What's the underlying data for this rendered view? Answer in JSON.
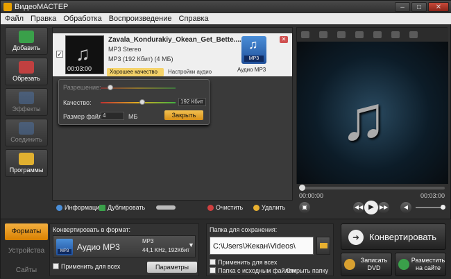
{
  "window": {
    "title": "ВидеоМАСТЕР",
    "minimize": "–",
    "maximize": "□",
    "close": "✕"
  },
  "menu": [
    "Файл",
    "Правка",
    "Обработка",
    "Воспроизведение",
    "Справка"
  ],
  "tools": [
    {
      "label": "Добавить",
      "icon": "add-film-icon",
      "color": "#3aa04a",
      "enabled": true
    },
    {
      "label": "Обрезать",
      "icon": "cut-film-icon",
      "color": "#c04040",
      "enabled": true
    },
    {
      "label": "Эффекты",
      "icon": "effects-icon",
      "color": "#5080c0",
      "enabled": false
    },
    {
      "label": "Соединить",
      "icon": "join-icon",
      "color": "#5080c0",
      "enabled": false
    },
    {
      "label": "Программы",
      "icon": "programs-icon",
      "color": "#e0b030",
      "enabled": true
    }
  ],
  "file": {
    "checked": "✓",
    "name": "Zavala_Kondurakiy_Okean_Get_Bette....mp3",
    "audio": "MP3 Stereo",
    "format": "MP3 (192 Кбит) (4 МБ)",
    "duration": "00:03:00",
    "quality_button": "Хорошее качество",
    "audio_settings": "Настройки аудио",
    "output_label": "Аудио MP3",
    "output_tag": "MP3",
    "remove": "✕"
  },
  "popup": {
    "resolution_label": "Разрешение:",
    "quality_label": "Качество:",
    "quality_value": "192 Кбит",
    "size_label": "Размер файла:",
    "size_value": "4",
    "size_unit": "МБ",
    "close_button": "Закрыть"
  },
  "listbar": {
    "info": "Информация",
    "duplicate": "Дублировать",
    "clear": "Очистить",
    "delete": "Удалить"
  },
  "player": {
    "time_start": "00:00:00",
    "time_end": "00:03:00",
    "progress": 0,
    "volume": 1.0
  },
  "bottom": {
    "tabs": [
      "Форматы",
      "Устройства",
      "Сайты"
    ],
    "active_tab": 0,
    "convert_to_label": "Конвертировать в формат:",
    "format_name": "Аудио MP3",
    "format_tag": "MP3",
    "format_detail_1": "MP3",
    "format_detail_2": "44,1 KHz, 192Кбит",
    "apply_all": "Применить для всех",
    "params_button": "Параметры",
    "save_folder_label": "Папка для сохранения:",
    "save_path": "C:\\Users\\Жекан\\Videos\\",
    "apply_all_folder": "Применить для всех",
    "source_folder": "Папка с исходным файлом",
    "open_folder": "Открыть папку",
    "convert_button": "Конвертировать",
    "burn_dvd": "Записать DVD",
    "publish": "Разместить на сайте"
  }
}
